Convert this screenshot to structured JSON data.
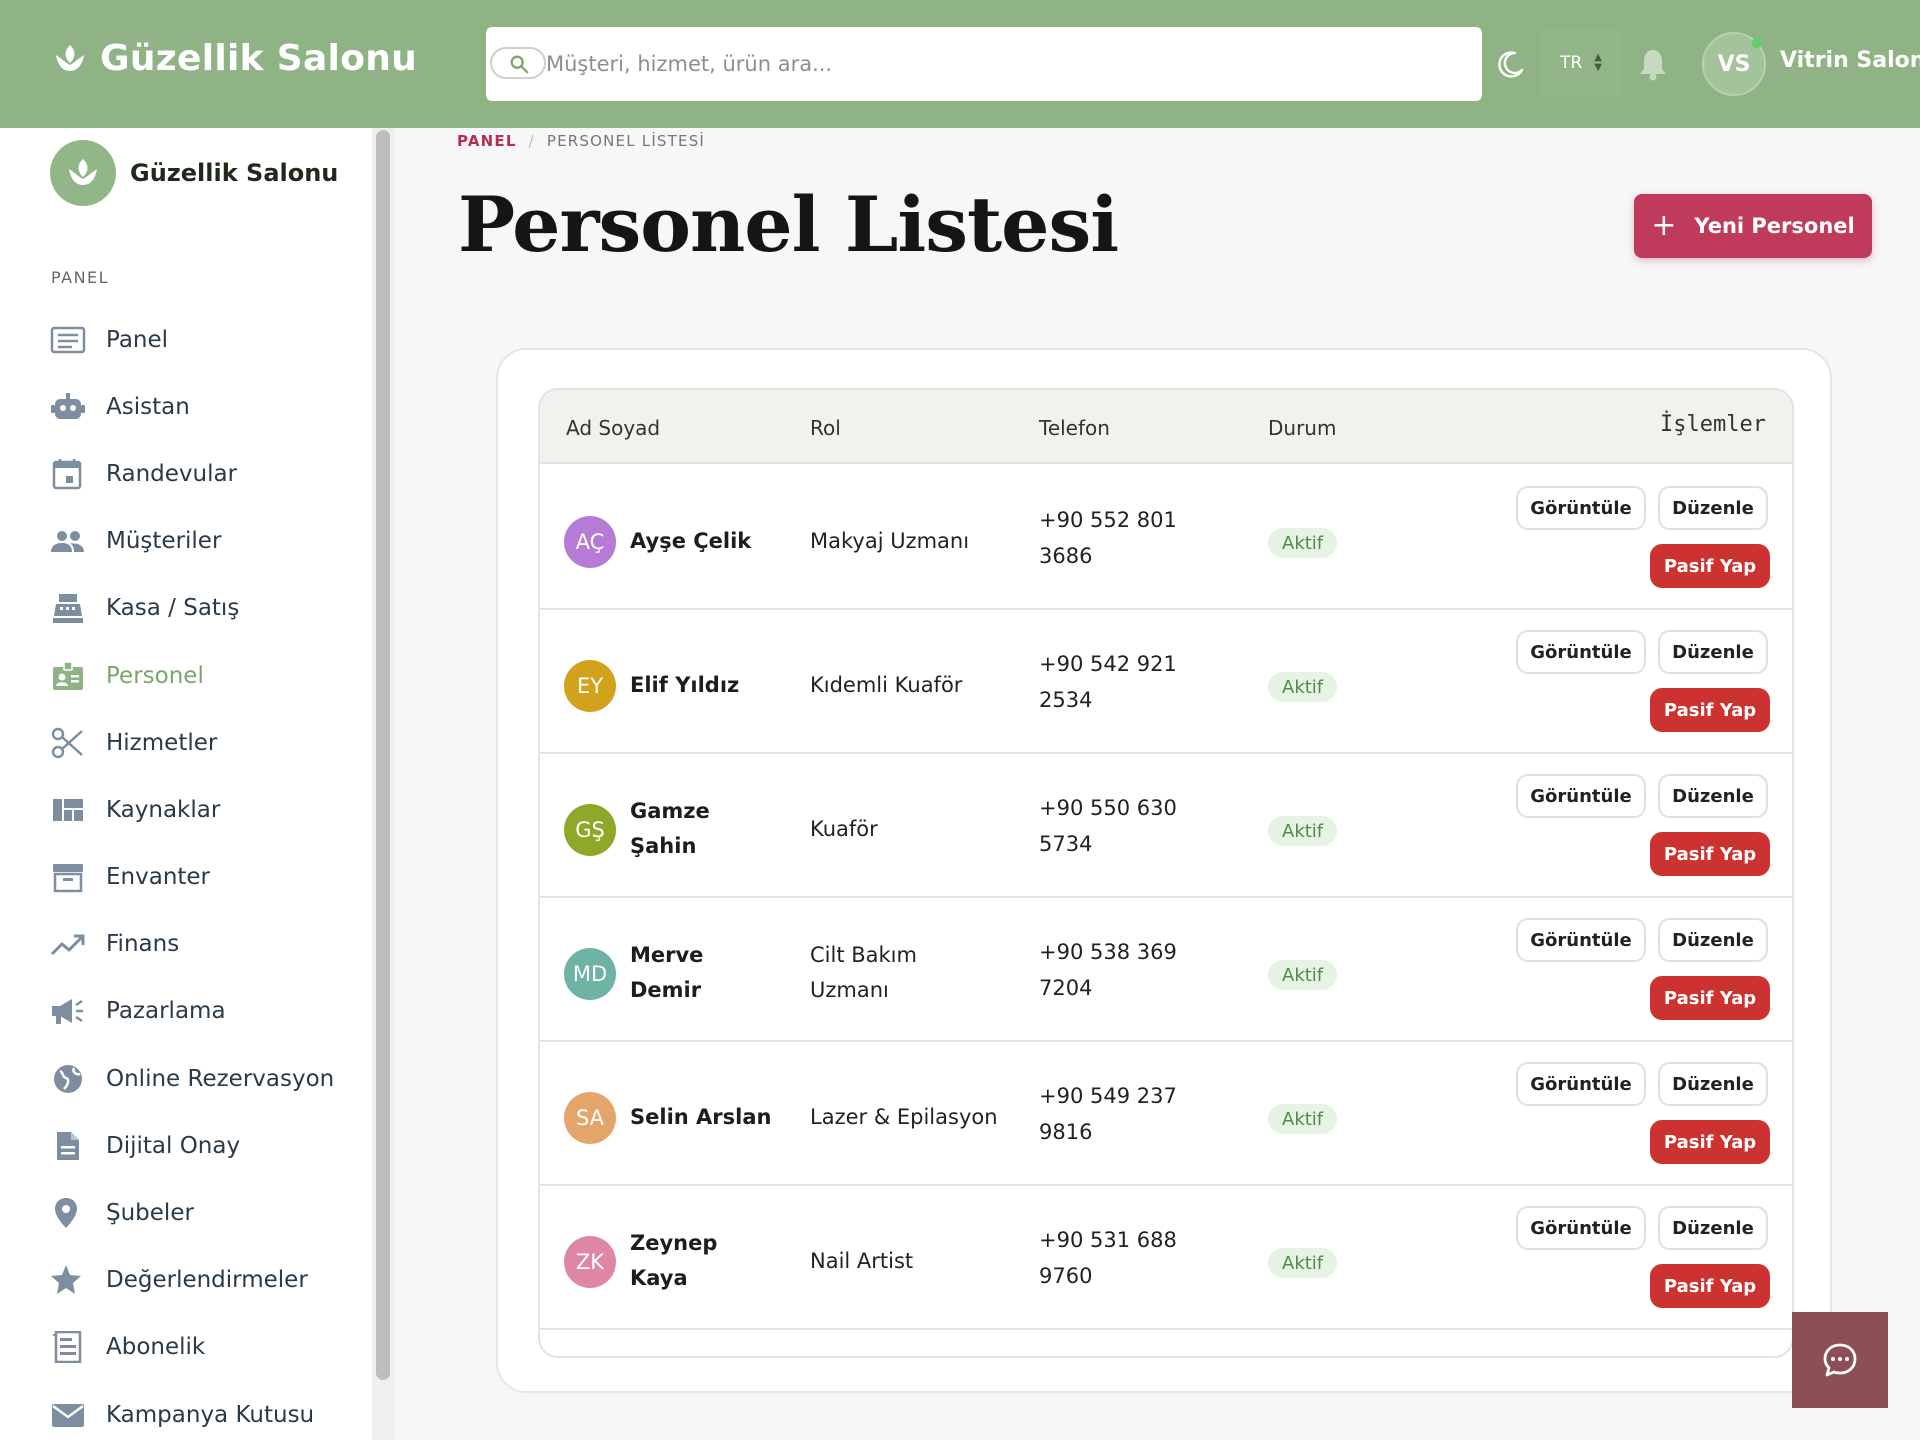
{
  "header": {
    "brand": "Güzellik Salonu",
    "search_placeholder": "Müşteri, hizmet, ürün ara...",
    "language": "TR",
    "user_initials": "VS",
    "user_name": "Vitrin Salon"
  },
  "sidebar": {
    "brand": "Güzellik Salonu",
    "section": "PANEL",
    "items": [
      {
        "label": "Panel",
        "icon": "dashboard-icon"
      },
      {
        "label": "Asistan",
        "icon": "robot-icon"
      },
      {
        "label": "Randevular",
        "icon": "calendar-icon"
      },
      {
        "label": "Müşteriler",
        "icon": "people-icon"
      },
      {
        "label": "Kasa / Satış",
        "icon": "cash-register-icon"
      },
      {
        "label": "Personel",
        "icon": "badge-icon",
        "active": true
      },
      {
        "label": "Hizmetler",
        "icon": "scissors-icon"
      },
      {
        "label": "Kaynaklar",
        "icon": "grid-icon"
      },
      {
        "label": "Envanter",
        "icon": "archive-icon"
      },
      {
        "label": "Finans",
        "icon": "trending-up-icon"
      },
      {
        "label": "Pazarlama",
        "icon": "megaphone-icon"
      },
      {
        "label": "Online Rezervasyon",
        "icon": "globe-icon"
      },
      {
        "label": "Dijital Onay",
        "icon": "document-icon"
      },
      {
        "label": "Şubeler",
        "icon": "location-pin-icon"
      },
      {
        "label": "Değerlendirmeler",
        "icon": "star-icon"
      },
      {
        "label": "Abonelik",
        "icon": "receipt-icon"
      },
      {
        "label": "Kampanya Kutusu",
        "icon": "mail-icon"
      }
    ]
  },
  "breadcrumb": {
    "root": "PANEL",
    "separator": "/",
    "current": "PERSONEL LİSTESİ"
  },
  "page": {
    "title": "Personel Listesi",
    "new_button": "Yeni Personel"
  },
  "table": {
    "columns": [
      "Ad Soyad",
      "Rol",
      "Telefon",
      "Durum",
      "İşlemler"
    ],
    "view_label": "Görüntüle",
    "edit_label": "Düzenle",
    "passive_label": "Pasif Yap",
    "rows": [
      {
        "initials": "AÇ",
        "name": [
          "Ayşe Çelik"
        ],
        "role": [
          "Makyaj Uzmanı"
        ],
        "phone": [
          "+90 552 801",
          "3686"
        ],
        "status": "Aktif",
        "avatar_color": "#b67bd6"
      },
      {
        "initials": "EY",
        "name": [
          "Elif Yıldız"
        ],
        "role": [
          "Kıdemli Kuaför"
        ],
        "phone": [
          "+90 542 921",
          "2534"
        ],
        "status": "Aktif",
        "avatar_color": "#d3a21c"
      },
      {
        "initials": "GŞ",
        "name": [
          "Gamze",
          "Şahin"
        ],
        "role": [
          "Kuaför"
        ],
        "phone": [
          "+90 550 630",
          "5734"
        ],
        "status": "Aktif",
        "avatar_color": "#8ea92a"
      },
      {
        "initials": "MD",
        "name": [
          "Merve",
          "Demir"
        ],
        "role": [
          "Cilt Bakım",
          "Uzmanı"
        ],
        "phone": [
          "+90 538 369",
          "7204"
        ],
        "status": "Aktif",
        "avatar_color": "#6fb3a4"
      },
      {
        "initials": "SA",
        "name": [
          "Selin Arslan"
        ],
        "role": [
          "Lazer & Epilasyon"
        ],
        "phone": [
          "+90 549 237",
          "9816"
        ],
        "status": "Aktif",
        "avatar_color": "#e4a56a"
      },
      {
        "initials": "ZK",
        "name": [
          "Zeynep",
          "Kaya"
        ],
        "role": [
          "Nail Artist"
        ],
        "phone": [
          "+90 531 688",
          "9760"
        ],
        "status": "Aktif",
        "avatar_color": "#df86a6"
      }
    ]
  },
  "colors": {
    "header_bg": "#8fb385",
    "accent": "#c03a5c",
    "danger": "#cc3330",
    "active_nav": "#7aa56e"
  }
}
